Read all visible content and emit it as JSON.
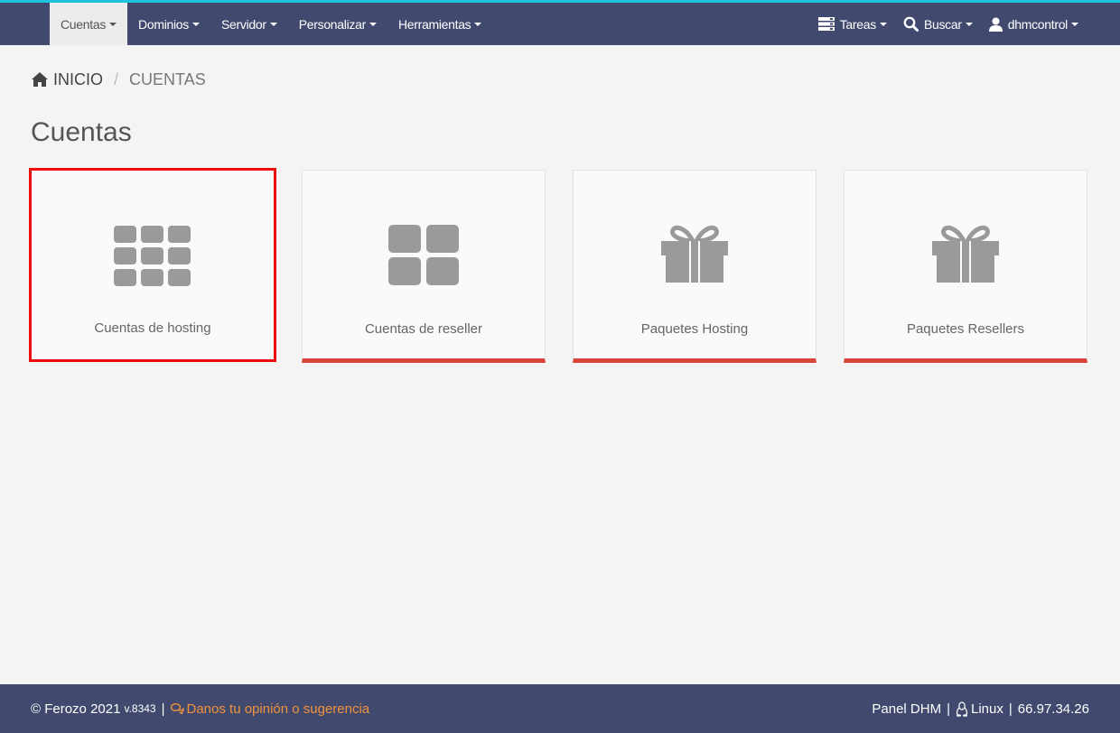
{
  "navbar": {
    "menu": [
      {
        "label": "Cuentas",
        "active": true
      },
      {
        "label": "Dominios",
        "active": false
      },
      {
        "label": "Servidor",
        "active": false
      },
      {
        "label": "Personalizar",
        "active": false
      },
      {
        "label": "Herramientas",
        "active": false
      }
    ],
    "right": {
      "tasks_label": "Tareas",
      "search_label": "Buscar",
      "user_label": "dhmcontrol"
    }
  },
  "breadcrumb": {
    "home": "INICIO",
    "separator": "/",
    "current": "CUENTAS"
  },
  "page_title": "Cuentas",
  "cards": [
    {
      "label": "Cuentas de hosting",
      "icon": "th-grid-icon",
      "selected": true
    },
    {
      "label": "Cuentas de reseller",
      "icon": "th-large-icon",
      "selected": false
    },
    {
      "label": "Paquetes Hosting",
      "icon": "gift-icon",
      "selected": false
    },
    {
      "label": "Paquetes Resellers",
      "icon": "gift-icon",
      "selected": false
    }
  ],
  "footer": {
    "copyright": "© Ferozo 2021",
    "version": "v.8343",
    "separator": "|",
    "feedback": "Danos tu opinión o sugerencia",
    "panel": "Panel DHM",
    "os": "Linux",
    "ip": "66.97.34.26"
  },
  "colors": {
    "navbar_bg": "#414a6e",
    "top_accent": "#1bc4dc",
    "card_bottom_border": "#d9453b",
    "selection_outline": "#ee0c0c",
    "feedback_link": "#f0923b"
  }
}
